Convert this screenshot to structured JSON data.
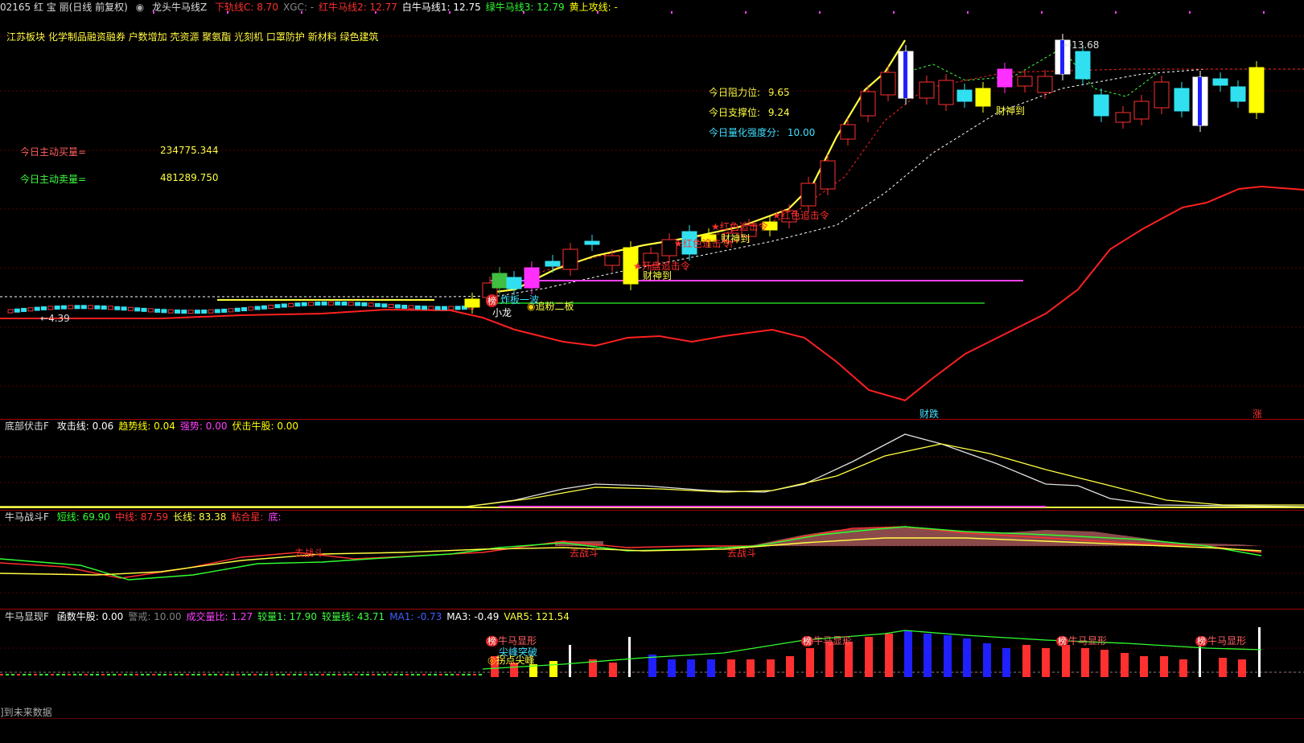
{
  "header": {
    "stock": "02165 红 宝 丽(日线 前复权)",
    "indicator_name": "龙头牛马线Z",
    "items": [
      {
        "label": "下轨线C:",
        "value": "8.70",
        "color": "#ff3030"
      },
      {
        "label": "XGC:",
        "value": "-",
        "color": "#888888"
      },
      {
        "label": "红牛马线2:",
        "value": "12.77",
        "color": "#ff3030"
      },
      {
        "label": "白牛马线1:",
        "value": "12.75",
        "color": "#ffffff"
      },
      {
        "label": "绿牛马线3:",
        "value": "12.79",
        "color": "#30ff30"
      },
      {
        "label": "黄上攻线:",
        "value": "-",
        "color": "#ffff00"
      }
    ]
  },
  "concepts": "江苏板块  化学制品融资融券 户数增加 壳资源  聚氨酯 光刻机 口罩防护 新材料 绿色建筑",
  "left_info": [
    {
      "label": "今日主动买量=",
      "value": "234775.344",
      "label_color": "#ff6060",
      "value_color": "#ffff40"
    },
    {
      "label": "今日主动卖量=",
      "value": "481289.750",
      "label_color": "#40ff40",
      "value_color": "#ffff40"
    }
  ],
  "right_info": [
    {
      "label": "今日阻力位:",
      "value": "9.65",
      "color": "#ffff40"
    },
    {
      "label": "今日支撑位:",
      "value": "9.24",
      "color": "#ffff40"
    },
    {
      "label": "今日量化强度分:",
      "value": "10.00",
      "color": "#40e0ff"
    }
  ],
  "main_annotations": {
    "high_price": "13.68",
    "low_price": "4.39",
    "caishen1": "财神到",
    "caishen2": "财神到",
    "caishen3": "财神到",
    "hongse1": "红色追击令",
    "hongse2": "红色追击令",
    "hongse3": "红色追击令",
    "kaipan": "开盘追击令",
    "xiaolong": "小龙",
    "bang": "榜",
    "zhaban": "炸板一波",
    "zhuifen": "追粉二板",
    "caidie": "财跌",
    "zhang": "涨"
  },
  "panel2": {
    "title": "底部伏击F",
    "items": [
      {
        "label": "攻击线:",
        "value": "0.06",
        "color": "#ffffff"
      },
      {
        "label": "趋势线:",
        "value": "0.04",
        "color": "#ffff00"
      },
      {
        "label": "强势:",
        "value": "0.00",
        "color": "#ff40ff"
      },
      {
        "label": "伏击牛股:",
        "value": "0.00",
        "color": "#ffff00"
      }
    ]
  },
  "panel3": {
    "title": "牛马战斗F",
    "items": [
      {
        "label": "短线:",
        "value": "69.90",
        "color": "#30ff30"
      },
      {
        "label": "中线:",
        "value": "87.59",
        "color": "#ff3030"
      },
      {
        "label": "长线:",
        "value": "83.38",
        "color": "#ffff40"
      },
      {
        "label": "粘合星:",
        "value": "",
        "color": "#ff3030"
      },
      {
        "label": "底:",
        "value": "",
        "color": "#ff40ff"
      }
    ],
    "qu_labels": [
      "去战斗",
      "去战斗",
      "去战斗"
    ]
  },
  "panel4": {
    "title": "牛马显现F",
    "items": [
      {
        "label": "函数牛股:",
        "value": "0.00",
        "color": "#ffffff"
      },
      {
        "label": "警戒:",
        "value": "10.00",
        "color": "#808080"
      },
      {
        "label": "成交量比:",
        "value": "1.27",
        "color": "#ff40ff"
      },
      {
        "label": "较量1:",
        "value": "17.90",
        "color": "#40ff40"
      },
      {
        "label": "较量线:",
        "value": "43.71",
        "color": "#40ff40"
      },
      {
        "label": "MA1:",
        "value": "-0.73",
        "color": "#4060ff"
      },
      {
        "label": "MA3:",
        "value": "-0.49",
        "color": "#ffffff"
      },
      {
        "label": "VAR5:",
        "value": "121.54",
        "color": "#ffff40"
      }
    ],
    "niuma_labels": [
      "牛马显形",
      "牛马显形",
      "牛马显形",
      "牛马显形"
    ],
    "bang": "榜",
    "jianfeng": "尖峰突破",
    "huodian": "拐点尖峰"
  },
  "footer": "]到未来数据"
}
